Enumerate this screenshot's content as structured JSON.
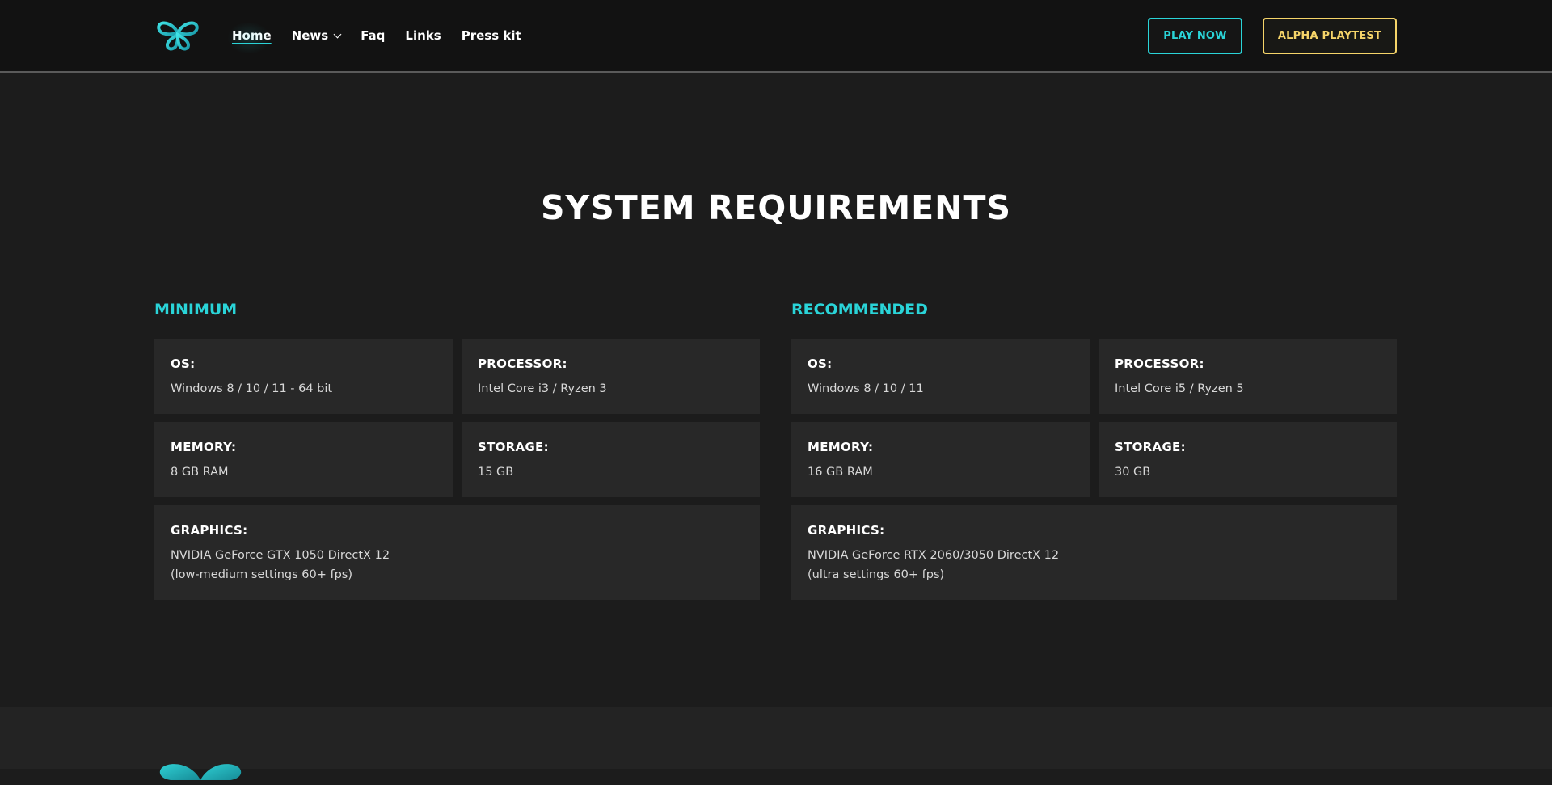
{
  "header": {
    "nav": {
      "home": "Home",
      "news": "News",
      "faq": "Faq",
      "links": "Links",
      "press_kit": "Press kit"
    },
    "play_now": "PLAY NOW",
    "alpha_playtest": "ALPHA PLAYTEST"
  },
  "requirements": {
    "title": "SYSTEM REQUIREMENTS",
    "minimum": {
      "heading": "MINIMUM",
      "os": {
        "label": "OS:",
        "value": "Windows 8 / 10 / 11 - 64 bit"
      },
      "processor": {
        "label": "PROCESSOR:",
        "value": "Intel Core i3 / Ryzen 3"
      },
      "memory": {
        "label": "MEMORY:",
        "value": "8 GB RAM"
      },
      "storage": {
        "label": "STORAGE:",
        "value": "15 GB"
      },
      "graphics": {
        "label": "GRAPHICS:",
        "line1": "NVIDIA GeForce GTX 1050 DirectX 12",
        "line2": "(low-medium settings 60+ fps)"
      }
    },
    "recommended": {
      "heading": "RECOMMENDED",
      "os": {
        "label": "OS:",
        "value": "Windows 8 / 10 / 11"
      },
      "processor": {
        "label": "PROCESSOR:",
        "value": "Intel Core i5 / Ryzen 5"
      },
      "memory": {
        "label": "MEMORY:",
        "value": "16 GB RAM"
      },
      "storage": {
        "label": "STORAGE:",
        "value": "30 GB"
      },
      "graphics": {
        "label": "GRAPHICS:",
        "line1": "NVIDIA GeForce RTX 2060/3050 DirectX 12",
        "line2": "(ultra settings 60+ fps)"
      }
    }
  },
  "colors": {
    "accent": "#2ad4d8",
    "gold": "#f5d469",
    "header_bg": "#121212",
    "page_bg": "#1c1c1c",
    "card_bg": "#282828"
  },
  "icons": {
    "logo": "butterfly-logo-icon",
    "news_dropdown": "chevron-down-icon",
    "footer_logo": "butterfly-logo-icon"
  }
}
